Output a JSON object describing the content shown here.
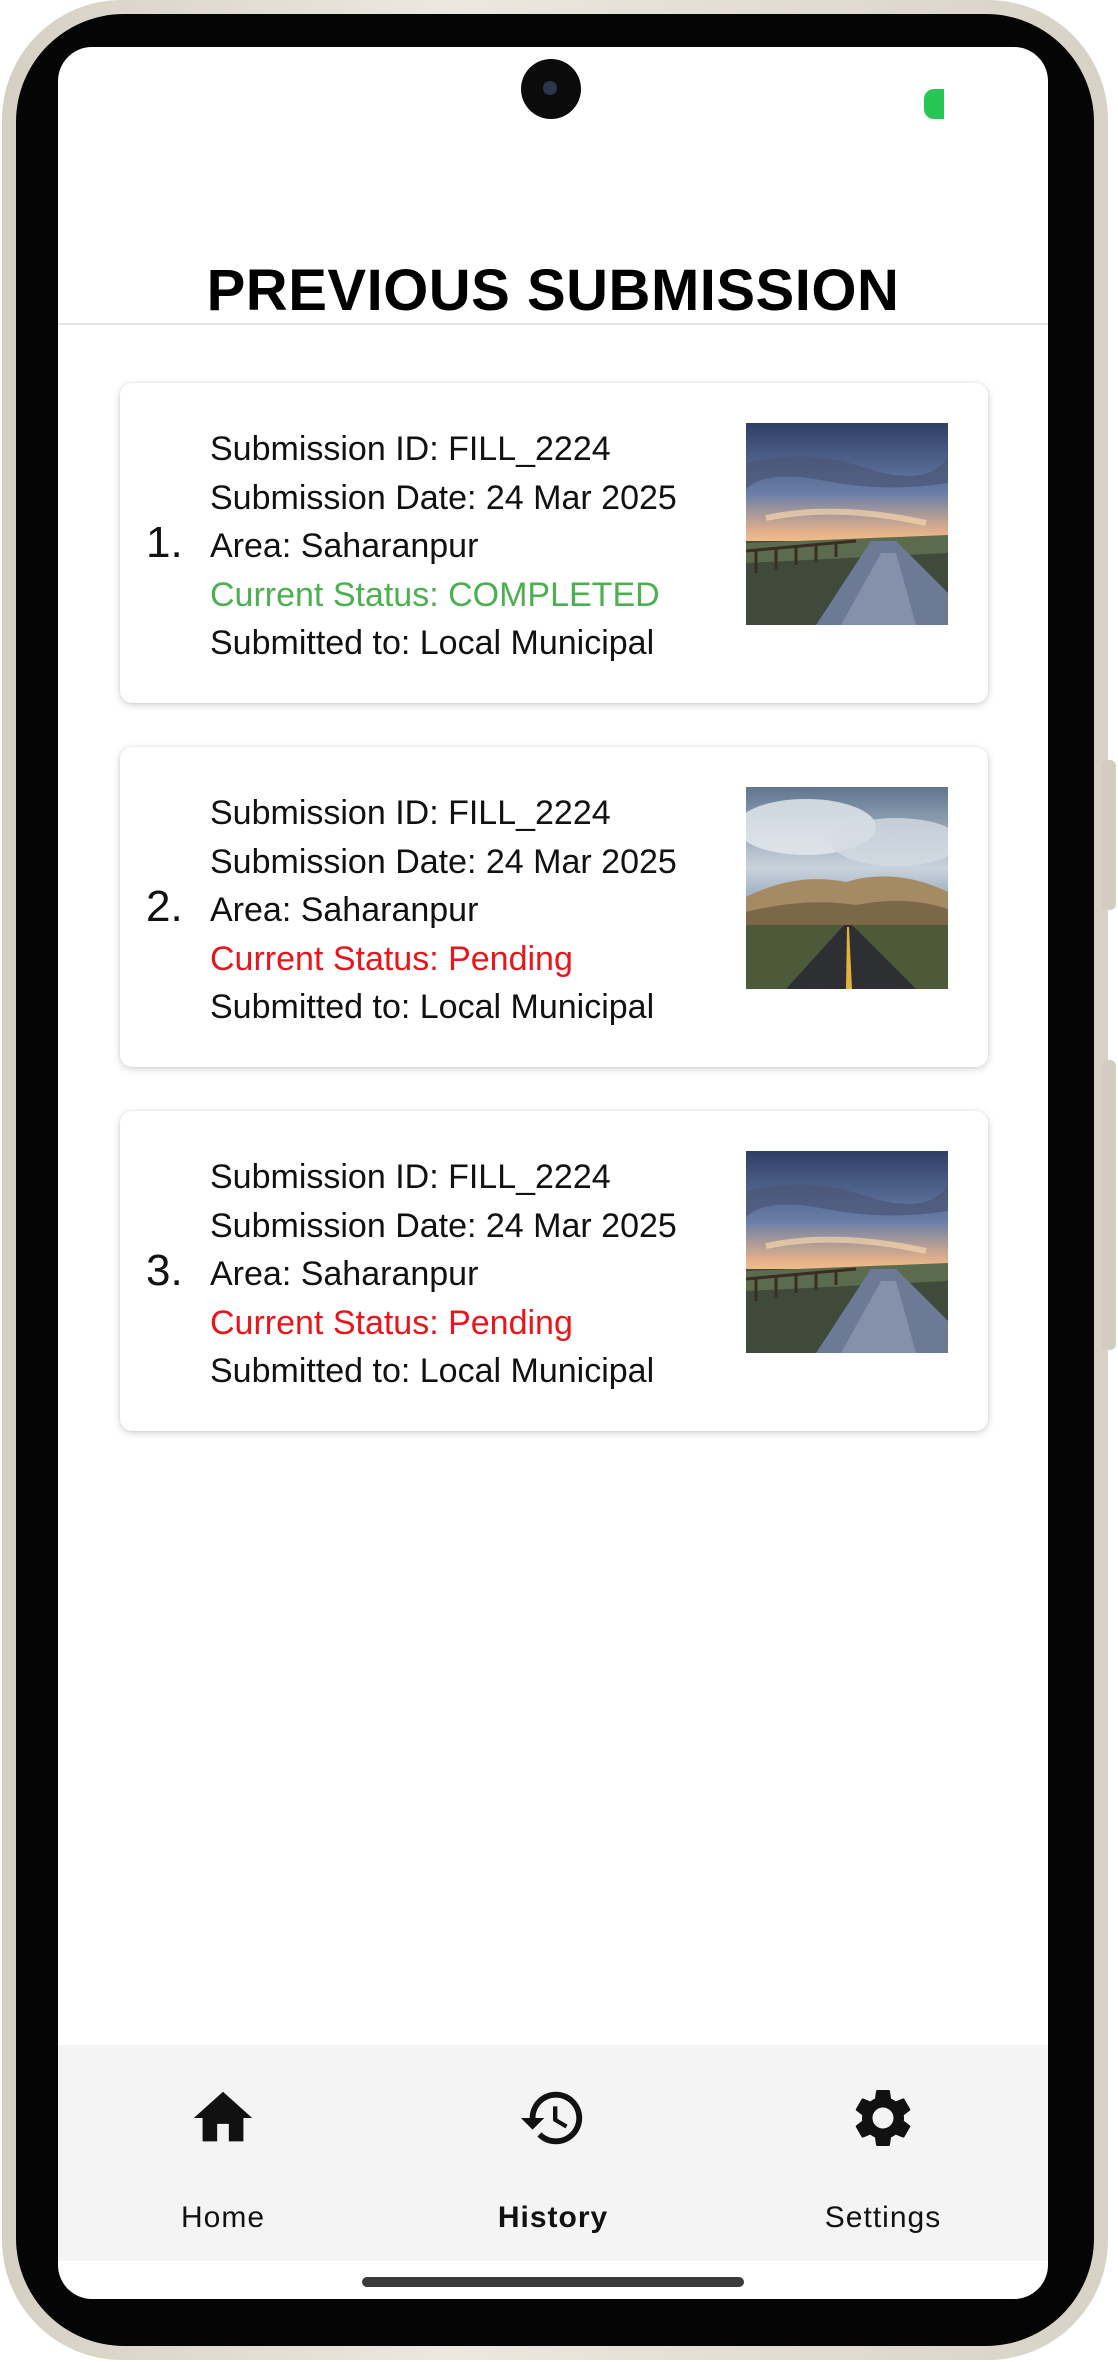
{
  "app": {
    "title": "PREVIOUS SUBMISSION"
  },
  "colors": {
    "status_completed": "#4caf50",
    "status_pending": "#e8151b",
    "nav_background": "#f4f4f4",
    "battery_indicator": "#27c653"
  },
  "submissions": [
    {
      "index": "1.",
      "id_line": "Submission ID: FILL_2224",
      "date_line": "Submission Date: 24 Mar 2025",
      "area_line": "Area: Saharanpur",
      "status_line": "Current Status: COMPLETED",
      "status": "completed",
      "submitted_to_line": "Submitted to: Local Municipal",
      "thumbnail": "road-sunset-photo"
    },
    {
      "index": "2.",
      "id_line": "Submission ID: FILL_2224",
      "date_line": "Submission Date: 24 Mar 2025",
      "area_line": "Area: Saharanpur",
      "status_line": "Current Status: Pending",
      "status": "pending",
      "submitted_to_line": "Submitted to: Local Municipal",
      "thumbnail": "highway-cloudy-photo"
    },
    {
      "index": "3.",
      "id_line": "Submission ID: FILL_2224",
      "date_line": "Submission Date: 24 Mar 2025",
      "area_line": "Area: Saharanpur",
      "status_line": "Current Status: Pending",
      "status": "pending",
      "submitted_to_line": "Submitted to: Local Municipal",
      "thumbnail": "road-sunset-photo"
    }
  ],
  "bottom_nav": {
    "items": [
      {
        "label": "Home",
        "icon": "home-icon",
        "active": false
      },
      {
        "label": "History",
        "icon": "history-icon",
        "active": true
      },
      {
        "label": "Settings",
        "icon": "gear-icon",
        "active": false
      }
    ]
  }
}
